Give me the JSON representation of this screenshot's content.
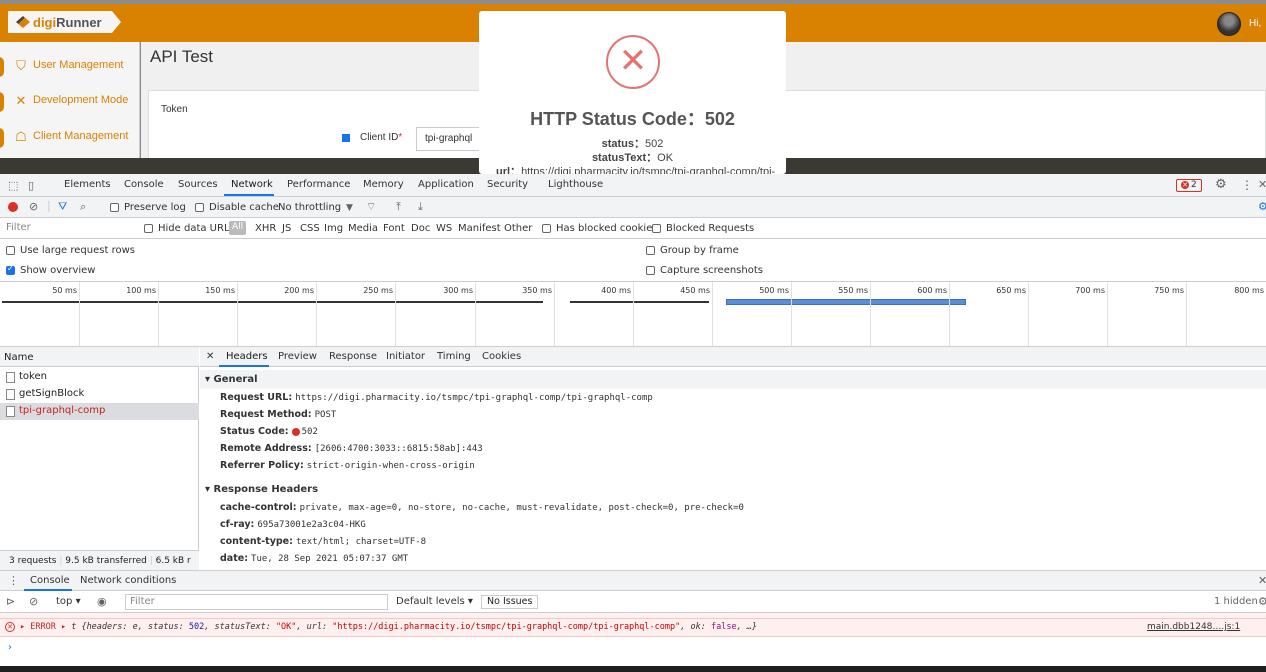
{
  "app": {
    "logo": {
      "part1": "digi",
      "part2": "Runner"
    },
    "user_greeting": "Hi,",
    "sidebar": [
      {
        "label": "User Management",
        "icon": "shield-icon"
      },
      {
        "label": "Development Mode",
        "icon": "tools-icon"
      },
      {
        "label": "Client Management",
        "icon": "sitemap-icon"
      }
    ],
    "page_title": "API Test",
    "token_label": "Token",
    "client_id_label": "Client ID",
    "client_id_required": "*",
    "client_id_value": "tpi-graphql"
  },
  "modal": {
    "icon": "error-x-icon",
    "title": "HTTP Status Code：502",
    "status_key": "status：",
    "status_val": "502",
    "statustext_key": "statusText：",
    "statustext_val": "OK",
    "url_key": "url：",
    "url_val": "https://digi.pharmacity.io/tsmpc/tpi-graphql-comp/tpi-"
  },
  "devtools": {
    "tabs": [
      "Elements",
      "Console",
      "Sources",
      "Network",
      "Performance",
      "Memory",
      "Application",
      "Security",
      "Lighthouse"
    ],
    "active_tab": "Network",
    "error_count": "2",
    "toolbar": {
      "preserve_log": "Preserve log",
      "disable_cache": "Disable cache",
      "throttling": "No throttling"
    },
    "filter": {
      "placeholder": "Filter",
      "hide_data_urls": "Hide data URLs",
      "types": [
        "All",
        "XHR",
        "JS",
        "CSS",
        "Img",
        "Media",
        "Font",
        "Doc",
        "WS",
        "Manifest",
        "Other"
      ],
      "has_blocked_cookies": "Has blocked cookies",
      "blocked_requests": "Blocked Requests"
    },
    "options": {
      "large_rows": "Use large request rows",
      "show_overview": "Show overview",
      "group_by_frame": "Group by frame",
      "capture_screenshots": "Capture screenshots"
    },
    "timeline_labels": [
      "50 ms",
      "100 ms",
      "150 ms",
      "200 ms",
      "250 ms",
      "300 ms",
      "350 ms",
      "400 ms",
      "450 ms",
      "500 ms",
      "550 ms",
      "600 ms",
      "650 ms",
      "700 ms",
      "750 ms",
      "800 ms"
    ],
    "requests": {
      "header": "Name",
      "items": [
        "token",
        "getSignBlock",
        "tpi-graphql-comp"
      ],
      "selected": "tpi-graphql-comp",
      "status": {
        "count": "3 requests",
        "transferred": "9.5 kB transferred",
        "resources": "6.5 kB r"
      }
    },
    "detail": {
      "tabs": [
        "Headers",
        "Preview",
        "Response",
        "Initiator",
        "Timing",
        "Cookies"
      ],
      "general_title": "General",
      "general": [
        {
          "k": "Request URL:",
          "v": "https://digi.pharmacity.io/tsmpc/tpi-graphql-comp/tpi-graphql-comp"
        },
        {
          "k": "Request Method:",
          "v": "POST"
        },
        {
          "k": "Status Code:",
          "v": "502"
        },
        {
          "k": "Remote Address:",
          "v": "[2606:4700:3033::6815:58ab]:443"
        },
        {
          "k": "Referrer Policy:",
          "v": "strict-origin-when-cross-origin"
        }
      ],
      "response_title": "Response Headers",
      "response": [
        {
          "k": "cache-control:",
          "v": "private, max-age=0, no-store, no-cache, must-revalidate, post-check=0, pre-check=0"
        },
        {
          "k": "cf-ray:",
          "v": "695a73001e2a3c04-HKG"
        },
        {
          "k": "content-type:",
          "v": "text/html; charset=UTF-8"
        },
        {
          "k": "date:",
          "v": "Tue, 28 Sep 2021 05:07:37 GMT"
        }
      ]
    },
    "drawer": {
      "tabs": [
        "Console",
        "Network conditions"
      ],
      "context": "top",
      "filter_placeholder": "Filter",
      "levels": "Default levels",
      "issues": "No Issues",
      "hidden": "1 hidden",
      "error": {
        "prefix": "ERROR",
        "obj": "t",
        "p1": " {headers: e, status: ",
        "status": "502",
        "p2": ", statusText: ",
        "statusText": "\"OK\"",
        "p3": ", url: ",
        "url": "\"https://digi.pharmacity.io/tsmpc/tpi-graphql-comp/tpi-graphql-comp\"",
        "p4": ", ok: ",
        "ok": "false",
        "p5": ", …}",
        "source": "main.dbb1248….js:1"
      }
    }
  }
}
